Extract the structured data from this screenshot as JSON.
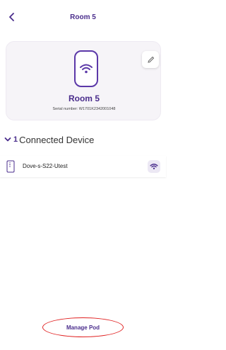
{
  "header": {
    "title": "Room 5"
  },
  "pod": {
    "name": "Room 5",
    "serial_label": "Serial number: W1701K2342001048"
  },
  "connected": {
    "count": "1",
    "label": "Connected Device",
    "devices": [
      {
        "name": "Dove-s-S22-Utest"
      }
    ]
  },
  "footer": {
    "manage_label": "Manage Pod"
  },
  "colors": {
    "brand_purple": "#4a2d8c",
    "icon_purple": "#5b38a8",
    "card_bg": "#f6f4f8",
    "highlight_red": "#e02020"
  },
  "icons": [
    "chevron-left-icon",
    "wifi-icon",
    "pencil-icon",
    "chevron-down-icon",
    "phone-icon"
  ]
}
